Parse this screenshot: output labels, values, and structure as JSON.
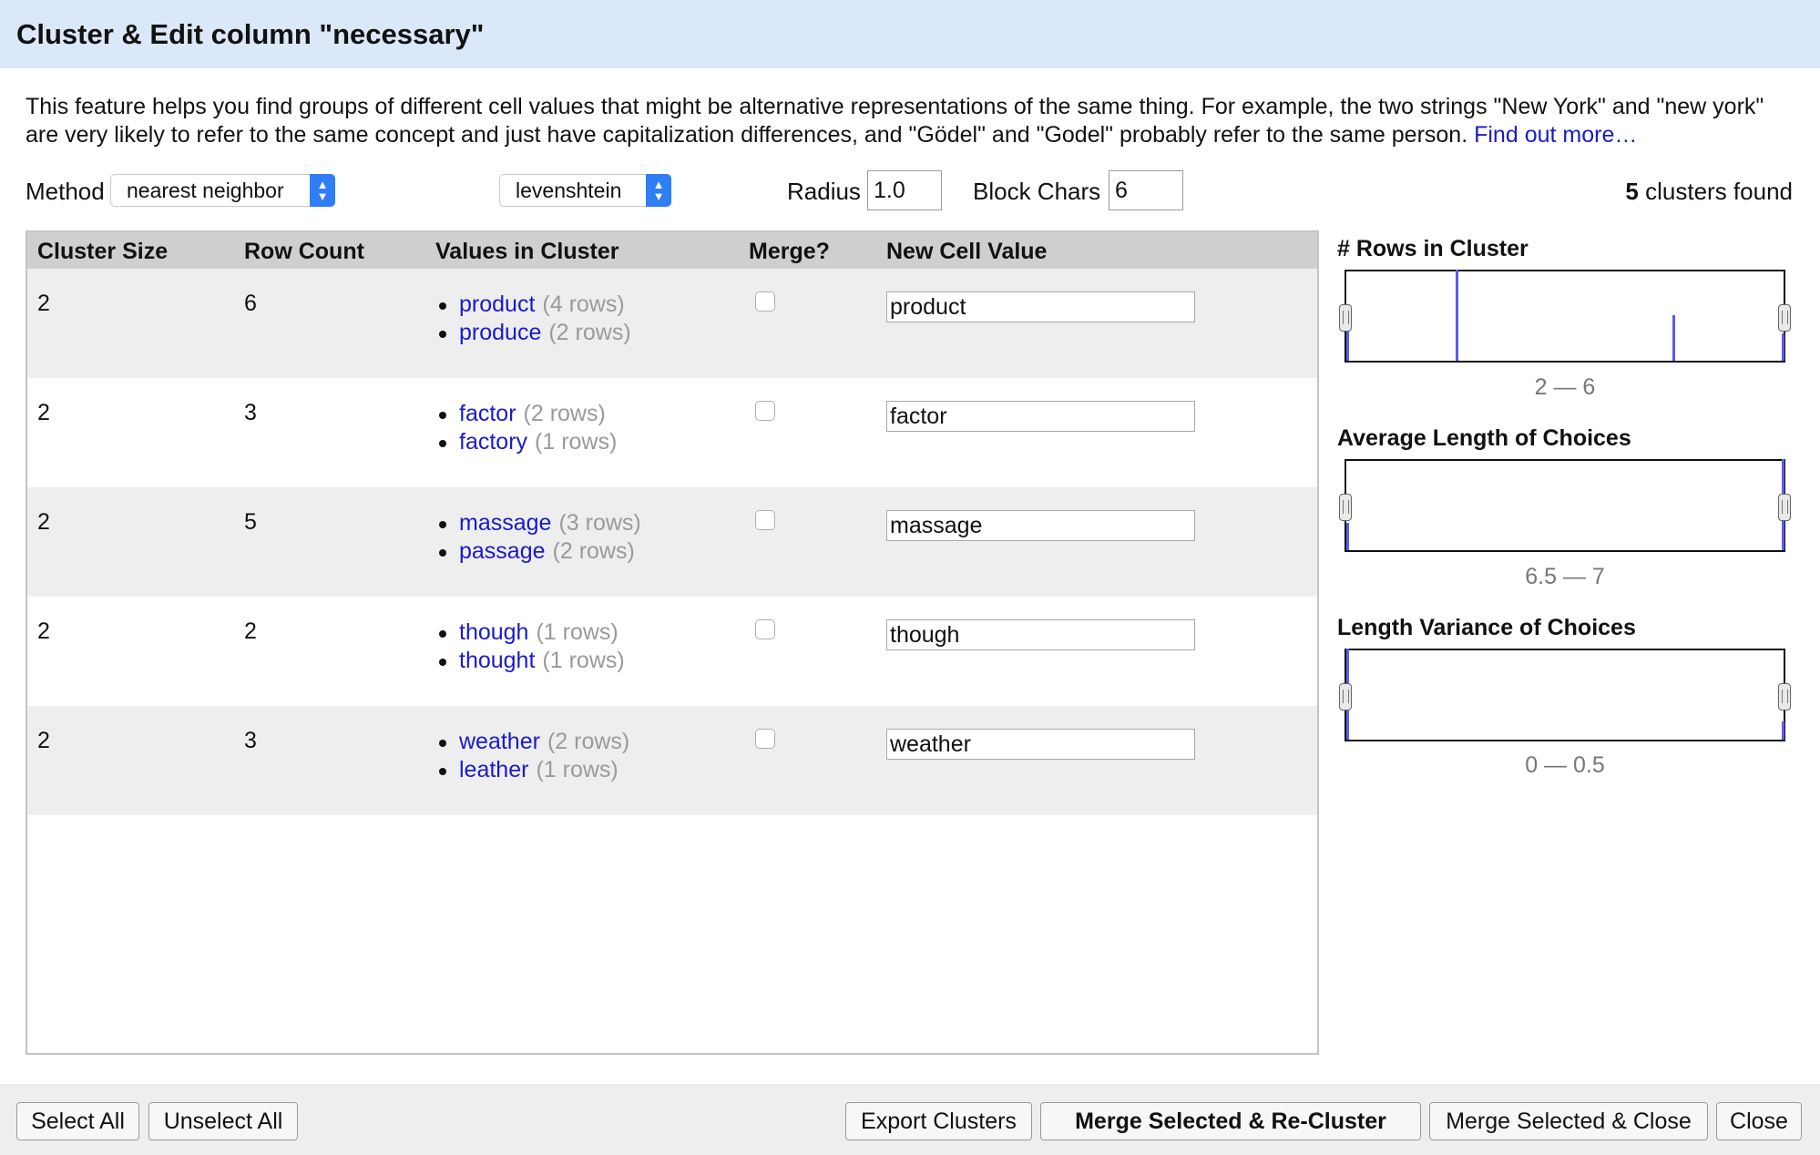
{
  "dialog": {
    "title": "Cluster & Edit column \"necessary\""
  },
  "description": {
    "text": "This feature helps you find groups of different cell values that might be alternative representations of the same thing. For example, the two strings \"New York\" and \"new york\" are very likely to refer to the same concept and just have capitalization differences, and \"Gödel\" and \"Godel\" probably refer to the same person.",
    "link": "Find out more…"
  },
  "controls": {
    "method_label": "Method",
    "method_value": "nearest neighbor",
    "function_value": "levenshtein",
    "radius_label": "Radius",
    "radius_value": "1.0",
    "block_chars_label": "Block Chars",
    "block_chars_value": "6",
    "clusters_count": "5",
    "clusters_found_text": "clusters found"
  },
  "table": {
    "headers": {
      "cluster_size": "Cluster Size",
      "row_count": "Row Count",
      "values": "Values in Cluster",
      "merge": "Merge?",
      "new_value": "New Cell Value"
    },
    "rows": [
      {
        "size": "2",
        "count": "6",
        "values": [
          {
            "value": "product",
            "rows": "(4 rows)"
          },
          {
            "value": "produce",
            "rows": "(2 rows)"
          }
        ],
        "merge": false,
        "new_value": "product"
      },
      {
        "size": "2",
        "count": "3",
        "values": [
          {
            "value": "factor",
            "rows": "(2 rows)"
          },
          {
            "value": "factory",
            "rows": "(1 rows)"
          }
        ],
        "merge": false,
        "new_value": "factor"
      },
      {
        "size": "2",
        "count": "5",
        "values": [
          {
            "value": "massage",
            "rows": "(3 rows)"
          },
          {
            "value": "passage",
            "rows": "(2 rows)"
          }
        ],
        "merge": false,
        "new_value": "massage"
      },
      {
        "size": "2",
        "count": "2",
        "values": [
          {
            "value": "though",
            "rows": "(1 rows)"
          },
          {
            "value": "thought",
            "rows": "(1 rows)"
          }
        ],
        "merge": false,
        "new_value": "though"
      },
      {
        "size": "2",
        "count": "3",
        "values": [
          {
            "value": "weather",
            "rows": "(2 rows)"
          },
          {
            "value": "leather",
            "rows": "(1 rows)"
          }
        ],
        "merge": false,
        "new_value": "weather"
      }
    ]
  },
  "facets": [
    {
      "title": "# Rows in Cluster",
      "range": "2 — 6"
    },
    {
      "title": "Average Length of Choices",
      "range": "6.5 — 7"
    },
    {
      "title": "Length Variance of Choices",
      "range": "0 — 0.5"
    }
  ],
  "footer": {
    "select_all": "Select All",
    "unselect_all": "Unselect All",
    "export": "Export Clusters",
    "merge_recluster": "Merge Selected & Re-Cluster",
    "merge_close": "Merge Selected & Close",
    "close": "Close"
  },
  "colors": {
    "title_bar": "#dbe8f9",
    "link": "#1a1acc",
    "histogram_bar": "#5b5bf2",
    "select_accent": "#2f7ef6"
  }
}
